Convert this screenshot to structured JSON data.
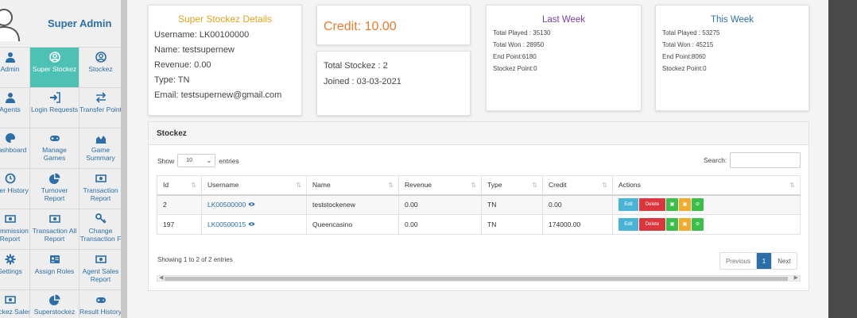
{
  "sidebar": {
    "title": "Super Admin",
    "items": [
      {
        "label": "Admin",
        "icon": "user-icon"
      },
      {
        "label": "Super Stockez",
        "icon": "user-circle-icon",
        "active": true
      },
      {
        "label": "Stockez",
        "icon": "user-circle-icon"
      },
      {
        "label": "Agents",
        "icon": "user-icon"
      },
      {
        "label": "Login Requests",
        "icon": "sign-in-icon"
      },
      {
        "label": "Transfer Point",
        "icon": "exchange-icon"
      },
      {
        "label": "Dashboard",
        "icon": "palette-icon"
      },
      {
        "label": "Manage Games",
        "icon": "gamepad-icon"
      },
      {
        "label": "Game Summary",
        "icon": "area-chart-icon"
      },
      {
        "label": "User History",
        "icon": "history-icon"
      },
      {
        "label": "Turnover Report",
        "icon": "pie-chart-icon"
      },
      {
        "label": "Transaction Report",
        "icon": "money-icon"
      },
      {
        "label": "Commission Report",
        "icon": "money-icon"
      },
      {
        "label": "Transaction All Report",
        "icon": "money-icon"
      },
      {
        "label": "Change Transaction F",
        "icon": "key-icon"
      },
      {
        "label": "Settings",
        "icon": "gear-icon"
      },
      {
        "label": "Assign Roles",
        "icon": "id-card-icon"
      },
      {
        "label": "Agent Sales Report",
        "icon": "money-icon"
      },
      {
        "label": "Stockez Sales",
        "icon": "money-icon"
      },
      {
        "label": "Superstockez",
        "icon": "pie-chart-icon"
      },
      {
        "label": "Result History",
        "icon": "gamepad-icon"
      }
    ]
  },
  "details": {
    "title": "Super Stockez Details",
    "username": "Username: LK00100000",
    "name": "Name: testsupernew",
    "revenue": "Revenue: 0.00",
    "type": "Type: TN",
    "email": "Email: testsupernew@gmail.com"
  },
  "credit": "Credit: 10.00",
  "summary": {
    "total_stockez": "Total Stockez : 2",
    "joined": "Joined : 03-03-2021"
  },
  "last_week": {
    "title": "Last Week",
    "total_played": "Total Played : 35130",
    "total_won": "Total Won : 28950",
    "end_point": "End Point:6180",
    "stockez_point": "Stockez Point:0"
  },
  "this_week": {
    "title": "This Week",
    "total_played": "Total Played : 53275",
    "total_won": "Total Won : 45215",
    "end_point": "End Point:8060",
    "stockez_point": "Stockez Point:0"
  },
  "stockez": {
    "heading": "Stockez",
    "show_label": "Show",
    "entries_value": "10",
    "entries_label": "entries",
    "search_label": "Search:",
    "columns": [
      "Id",
      "Username",
      "Name",
      "Revenue",
      "Type",
      "Credit",
      "Actions"
    ],
    "rows": [
      {
        "id": "2",
        "username": "LK00500000",
        "name": "teststockenew",
        "revenue": "0.00",
        "type": "TN",
        "credit": "0.00"
      },
      {
        "id": "197",
        "username": "LK00500015",
        "name": "Queencasino",
        "revenue": "0.00",
        "type": "TN",
        "credit": "174000.00"
      }
    ],
    "actions": {
      "edit": "Edit",
      "delete": "Delete"
    },
    "info": "Showing 1 to 2 of 2 entries",
    "pager": {
      "prev": "Previous",
      "page": "1",
      "next": "Next"
    }
  },
  "colors": {
    "accent": "#2c6fa8",
    "active": "#4ec1b5",
    "credit": "#e87b2b",
    "details_title": "#e3a31b",
    "last_week_title": "#7b3ea6"
  }
}
